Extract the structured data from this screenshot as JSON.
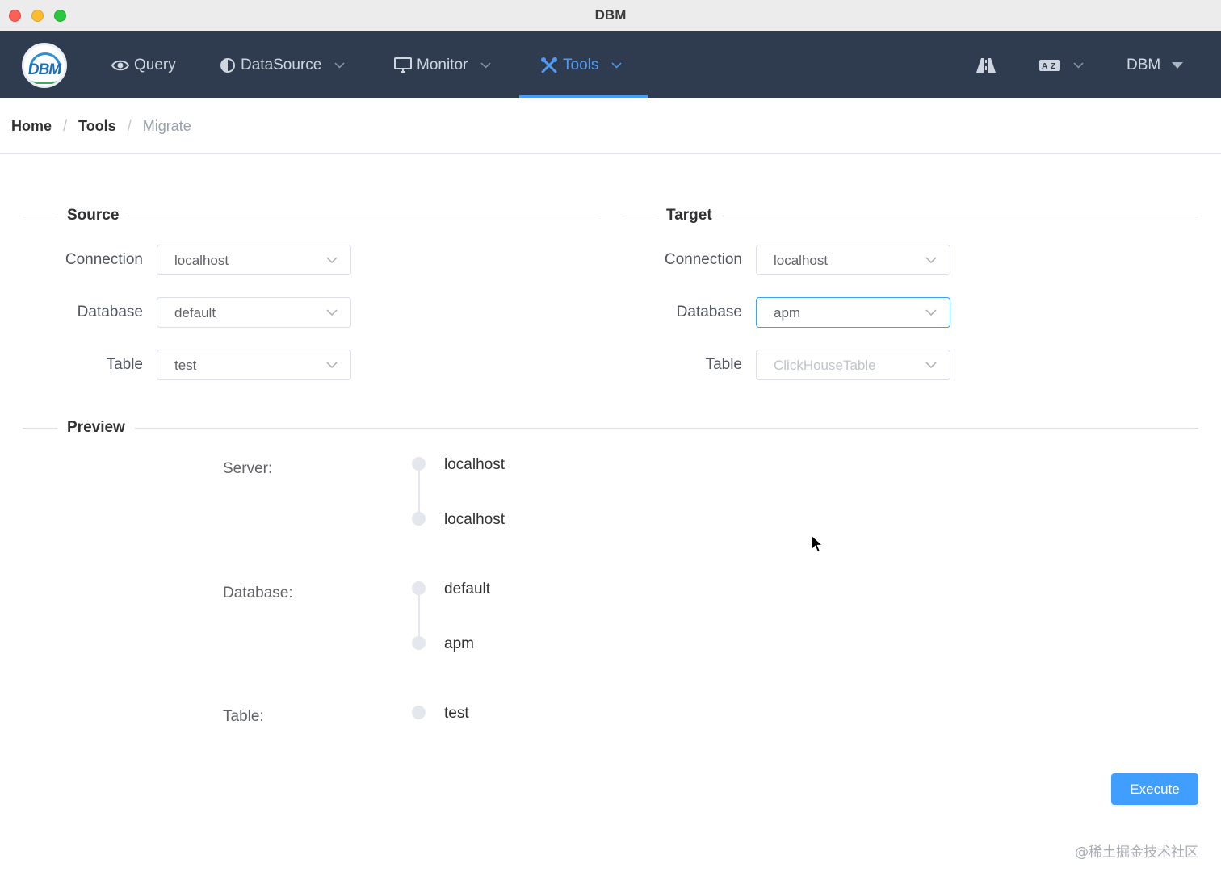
{
  "window": {
    "title": "DBM"
  },
  "navbar": {
    "logo_text": "DBM",
    "items": [
      {
        "label": "Query",
        "icon": "eye-icon",
        "has_dropdown": false
      },
      {
        "label": "DataSource",
        "icon": "half-circle-icon",
        "has_dropdown": true
      },
      {
        "label": "Monitor",
        "icon": "monitor-icon",
        "has_dropdown": true
      },
      {
        "label": "Tools",
        "icon": "tools-icon",
        "has_dropdown": true,
        "active": true
      }
    ],
    "right": {
      "road_icon": "road-icon",
      "language_icon": "translate-icon",
      "user": "DBM"
    },
    "colors": {
      "background": "#2f3b4f",
      "active": "#409eff",
      "text": "#cfd6e0"
    }
  },
  "breadcrumb": {
    "items": [
      "Home",
      "Tools",
      "Migrate"
    ]
  },
  "source": {
    "title": "Source",
    "connection_label": "Connection",
    "connection_value": "localhost",
    "database_label": "Database",
    "database_value": "default",
    "table_label": "Table",
    "table_value": "test"
  },
  "target": {
    "title": "Target",
    "connection_label": "Connection",
    "connection_value": "localhost",
    "database_label": "Database",
    "database_value": "apm",
    "table_label": "Table",
    "table_placeholder": "ClickHouseTable"
  },
  "preview": {
    "title": "Preview",
    "server_label": "Server:",
    "servers": [
      "localhost",
      "localhost"
    ],
    "database_label": "Database:",
    "databases": [
      "default",
      "apm"
    ],
    "table_label": "Table:",
    "tables": [
      "test"
    ]
  },
  "actions": {
    "execute": "Execute"
  },
  "watermark": "@稀土掘金技术社区"
}
